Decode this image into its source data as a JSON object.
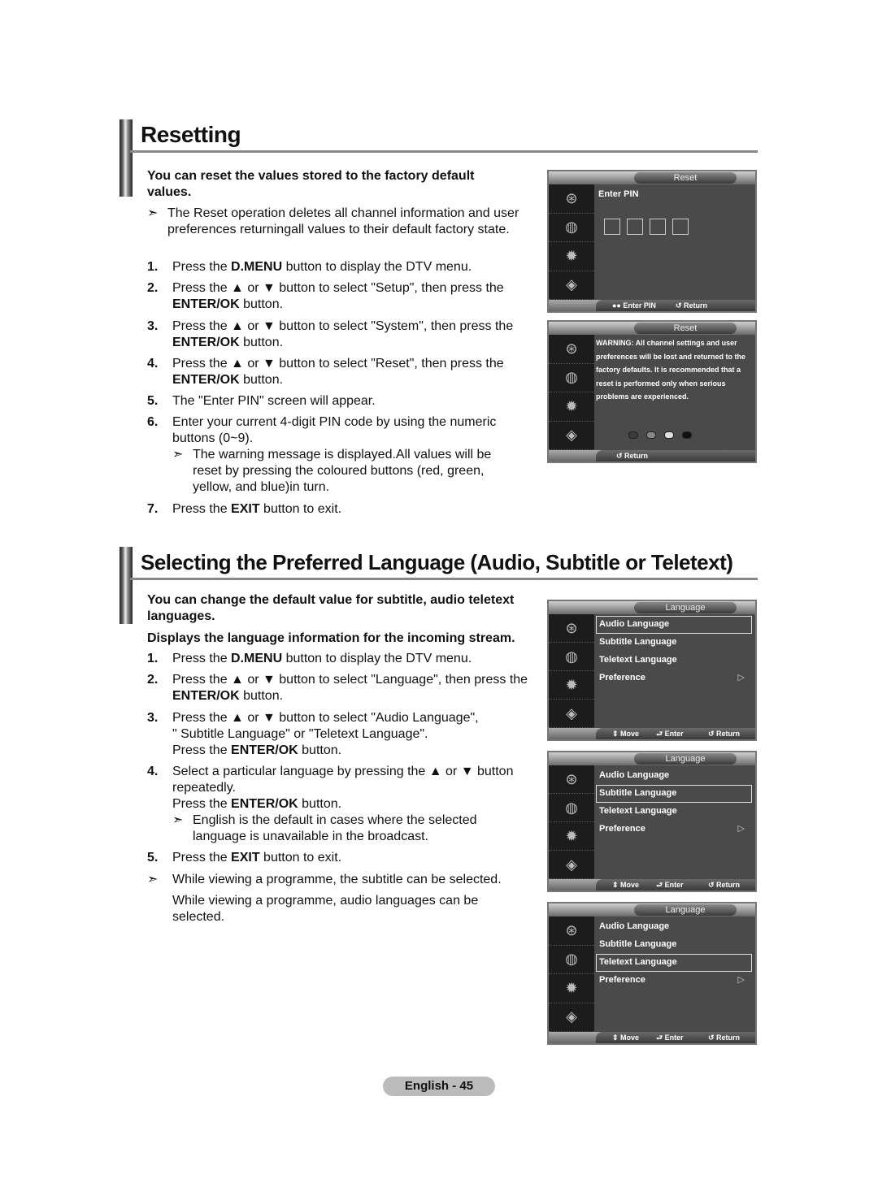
{
  "sections": [
    {
      "title": "Resetting",
      "intro": "You can reset the values stored to the factory default values.",
      "note_intro": "The Reset operation deletes all channel information and user preferences returningall values to their default factory state.",
      "steps": [
        {
          "num": "1.",
          "pre": "Press the ",
          "bold": "D.MENU",
          "post": " button to display the DTV menu."
        },
        {
          "num": "2.",
          "pre": "Press the ▲ or ▼ button to select \"Setup\", then press the ",
          "bold": "ENTER/OK",
          "post": " button."
        },
        {
          "num": "3.",
          "pre": "Press the ▲ or ▼ button to select \"System\", then press the ",
          "bold": "ENTER/OK",
          "post": " button."
        },
        {
          "num": "4.",
          "pre": "Press the ▲ or ▼ button to select \"Reset\", then press the ",
          "bold": "ENTER/OK",
          "post": " button."
        },
        {
          "num": "5.",
          "text": "The \"Enter PIN\" screen will appear."
        },
        {
          "num": "6.",
          "text": "Enter your current 4-digit PIN code by using the numeric buttons (0~9)."
        },
        {
          "num": "7.",
          "pre": "Press the ",
          "bold": "EXIT",
          "post": " button to exit."
        }
      ],
      "step6_note": "The warning message is displayed.All values will be reset by pressing the coloured buttons (red, green, yellow, and blue)in turn."
    },
    {
      "title": "Selecting the Preferred Language (Audio, Subtitle or Teletext)",
      "intro": "You can change the default value for subtitle, audio teletext languages.",
      "intro2": "Displays the language information for the incoming stream.",
      "steps": [
        {
          "num": "1.",
          "pre": "Press the ",
          "bold": "D.MENU",
          "post": " button to display the DTV menu."
        },
        {
          "num": "2.",
          "pre": "Press the ▲ or ▼ button to select \"Language\", then press the ",
          "bold": "ENTER/OK",
          "post": " button."
        },
        {
          "num": "3.",
          "line1": "Press the ▲ or ▼ button to select \"Audio Language\",",
          "line2": "\" Subtitle Language\" or \"Teletext Language\".",
          "pre": "Press the ",
          "bold": "ENTER/OK",
          "post": " button."
        },
        {
          "num": "4.",
          "line1": "Select a particular language by pressing the ▲ or ▼ button repeatedly.",
          "pre": "Press the ",
          "bold": "ENTER/OK",
          "post": " button."
        },
        {
          "num": "5.",
          "pre": "Press the ",
          "bold": "EXIT",
          "post": " button to exit."
        }
      ],
      "step4_note": "English is the default in cases where the selected language is unavailable in the broadcast.",
      "final_note": "While viewing a programme, the subtitle can be selected.",
      "final_text": "While viewing a programme, audio languages can be selected."
    }
  ],
  "osd_screens": [
    {
      "title": "Reset",
      "heading": "Enter PIN",
      "pin_digits": 4,
      "footer": [
        "●● Enter PIN",
        "↺ Return"
      ]
    },
    {
      "title": "Reset",
      "warning": "WARNING: All channel settings and user preferences will be lost and returned to the factory defaults. It is recommended that a reset is performed only when serious problems are experienced.",
      "color_dots": [
        "#3a3a3a",
        "#888888",
        "#e0e0e0",
        "#111111"
      ],
      "footer": [
        "↺ Return"
      ]
    },
    {
      "title": "Language",
      "items": [
        "Audio Language",
        "Subtitle Language",
        "Teletext Language",
        "Preference"
      ],
      "selected": 0,
      "footer": [
        "⇕ Move",
        "⮐ Enter",
        "↺ Return"
      ]
    },
    {
      "title": "Language",
      "items": [
        "Audio Language",
        "Subtitle Language",
        "Teletext Language",
        "Preference"
      ],
      "selected": 1,
      "footer": [
        "⇕ Move",
        "⮐ Enter",
        "↺ Return"
      ]
    },
    {
      "title": "Language",
      "items": [
        "Audio Language",
        "Subtitle Language",
        "Teletext Language",
        "Preference"
      ],
      "selected": 2,
      "footer": [
        "⇕ Move",
        "⮐ Enter",
        "↺ Return"
      ]
    }
  ],
  "sidebar_icons": [
    "antenna-icon",
    "satellite-dish-icon",
    "gear-icon",
    "globe-icon"
  ],
  "arrow_glyph": "➣",
  "page_label": "English - 45"
}
